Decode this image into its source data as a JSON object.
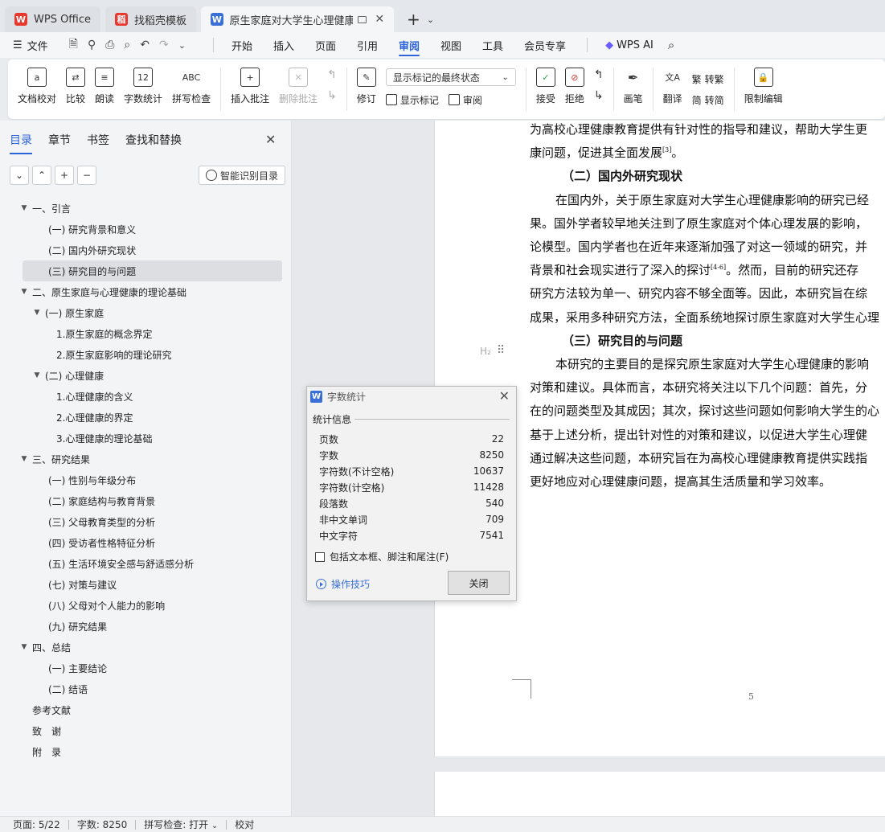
{
  "tabs": [
    {
      "label": "WPS Office",
      "icon": "wps-logo-icon",
      "color": "#e8382e"
    },
    {
      "label": "找稻壳模板",
      "icon": "docer-icon",
      "color": "#e8382e"
    },
    {
      "label": "原生家庭对大学生心理健康影响",
      "icon": "word-doc-icon",
      "color": "#3b6fd8"
    }
  ],
  "menu": {
    "file": "文件",
    "items": [
      "开始",
      "插入",
      "页面",
      "引用",
      "审阅",
      "视图",
      "工具",
      "会员专享"
    ],
    "active": "审阅",
    "wps_ai": "WPS AI"
  },
  "ribbon": {
    "doc_check": "文档校对",
    "compare": "比较",
    "read_aloud": "朗读",
    "word_count": "字数统计",
    "word_count_icon": "12",
    "spell_check": "拼写检查",
    "spell_icon": "ABC",
    "insert_comment": "插入批注",
    "delete_comment": "删除批注",
    "track_changes": "修订",
    "markup_select": "显示标记的最终状态",
    "show_markup": "显示标记",
    "review": "审阅",
    "accept": "接受",
    "reject": "拒绝",
    "pen": "画笔",
    "translate": "翻译",
    "to_traditional": "转繁",
    "to_simplified": "转简",
    "restrict_edit": "限制编辑"
  },
  "nav": {
    "tabs": [
      "目录",
      "章节",
      "书签",
      "查找和替换"
    ],
    "active_tab": "目录",
    "smart_btn": "智能识别目录",
    "toc": [
      {
        "label": "一、引言",
        "level": 0,
        "arrow": true
      },
      {
        "label": "(一) 研究背景和意义",
        "level": 1
      },
      {
        "label": "(二) 国内外研究现状",
        "level": 1
      },
      {
        "label": "(三) 研究目的与问题",
        "level": 1,
        "selected": true
      },
      {
        "label": "二、原生家庭与心理健康的理论基础",
        "level": 0,
        "arrow": true
      },
      {
        "label": "(一) 原生家庭",
        "level": 1,
        "arrow": true
      },
      {
        "label": "1.原生家庭的概念界定",
        "level": 2
      },
      {
        "label": "2.原生家庭影响的理论研究",
        "level": 2
      },
      {
        "label": "(二) 心理健康",
        "level": 1,
        "arrow": true
      },
      {
        "label": "1.心理健康的含义",
        "level": 2
      },
      {
        "label": "2.心理健康的界定",
        "level": 2
      },
      {
        "label": "3.心理健康的理论基础",
        "level": 2
      },
      {
        "label": "三、研究结果",
        "level": 0,
        "arrow": true
      },
      {
        "label": "(一)   性别与年级分布",
        "level": 1
      },
      {
        "label": "(二) 家庭结构与教育背景",
        "level": 1
      },
      {
        "label": "(三) 父母教育类型的分析",
        "level": 1
      },
      {
        "label": "(四) 受访者性格特征分析",
        "level": 1
      },
      {
        "label": "(五) 生活环境安全感与舒适感分析",
        "level": 1
      },
      {
        "label": "(七) 对策与建议",
        "level": 1
      },
      {
        "label": "(八) 父母对个人能力的影响",
        "level": 1
      },
      {
        "label": "(九) 研究结果",
        "level": 1
      },
      {
        "label": "四、总结",
        "level": 0,
        "arrow": true
      },
      {
        "label": "(一) 主要结论",
        "level": 1
      },
      {
        "label": "(二) 结语",
        "level": 1
      },
      {
        "label": "参考文献",
        "level": 0
      },
      {
        "label": "致　谢",
        "level": 0
      },
      {
        "label": "附　录",
        "level": 0
      }
    ]
  },
  "document": {
    "lines": [
      {
        "text": "为高校心理健康教育提供有针对性的指导和建议，帮助大学生更",
        "type": "body"
      },
      {
        "text": "康问题，促进其全面发展",
        "sup": "[3]",
        "after": "。",
        "type": "body"
      },
      {
        "text": "（二）国内外研究现状",
        "type": "heading"
      },
      {
        "text": "在国内外，关于原生家庭对大学生心理健康影响的研究已经",
        "type": "indent"
      },
      {
        "text": "果。国外学者较早地关注到了原生家庭对个体心理发展的影响，",
        "type": "body"
      },
      {
        "text": "论模型。国内学者也在近年来逐渐加强了对这一领域的研究，并",
        "type": "body"
      },
      {
        "text": "背景和社会现实进行了深入的探讨",
        "sup": "[4-6]",
        "after": "。然而，目前的研究还存",
        "type": "body"
      },
      {
        "text": "研究方法较为单一、研究内容不够全面等。因此，本研究旨在综",
        "type": "body"
      },
      {
        "text": "成果，采用多种研究方法，全面系统地探讨原生家庭对大学生心理",
        "type": "body"
      },
      {
        "text": "（三）研究目的与问题",
        "type": "heading"
      },
      {
        "text": "本研究的主要目的是探究原生家庭对大学生心理健康的影响",
        "type": "indent"
      },
      {
        "text": "对策和建议。具体而言，本研究将关注以下几个问题：首先，分",
        "type": "body"
      },
      {
        "text": "在的问题类型及其成因；其次，探讨这些问题如何影响大学生的心",
        "type": "body"
      },
      {
        "text": "基于上述分析，提出针对性的对策和建议，以促进大学生心理健",
        "type": "body"
      },
      {
        "text": "通过解决这些问题，本研究旨在为高校心理健康教育提供实践指",
        "type": "body"
      },
      {
        "text": "更好地应对心理健康问题，提高其生活质量和学习效率。",
        "type": "body"
      }
    ],
    "h2_marker": "H₂",
    "page_number": "5"
  },
  "dialog": {
    "title": "字数统计",
    "section": "统计信息",
    "stats": [
      {
        "label": "页数",
        "value": "22"
      },
      {
        "label": "字数",
        "value": "8250"
      },
      {
        "label": "字符数(不计空格)",
        "value": "10637"
      },
      {
        "label": "字符数(计空格)",
        "value": "11428"
      },
      {
        "label": "段落数",
        "value": "540"
      },
      {
        "label": "非中文单词",
        "value": "709"
      },
      {
        "label": "中文字符",
        "value": "7541"
      }
    ],
    "checkbox": "包括文本框、脚注和尾注(F)",
    "tips": "操作技巧",
    "close": "关闭"
  },
  "status": {
    "page": "页面: 5/22",
    "words": "字数: 8250",
    "spell": "拼写检查: 打开",
    "proof": "校对"
  }
}
